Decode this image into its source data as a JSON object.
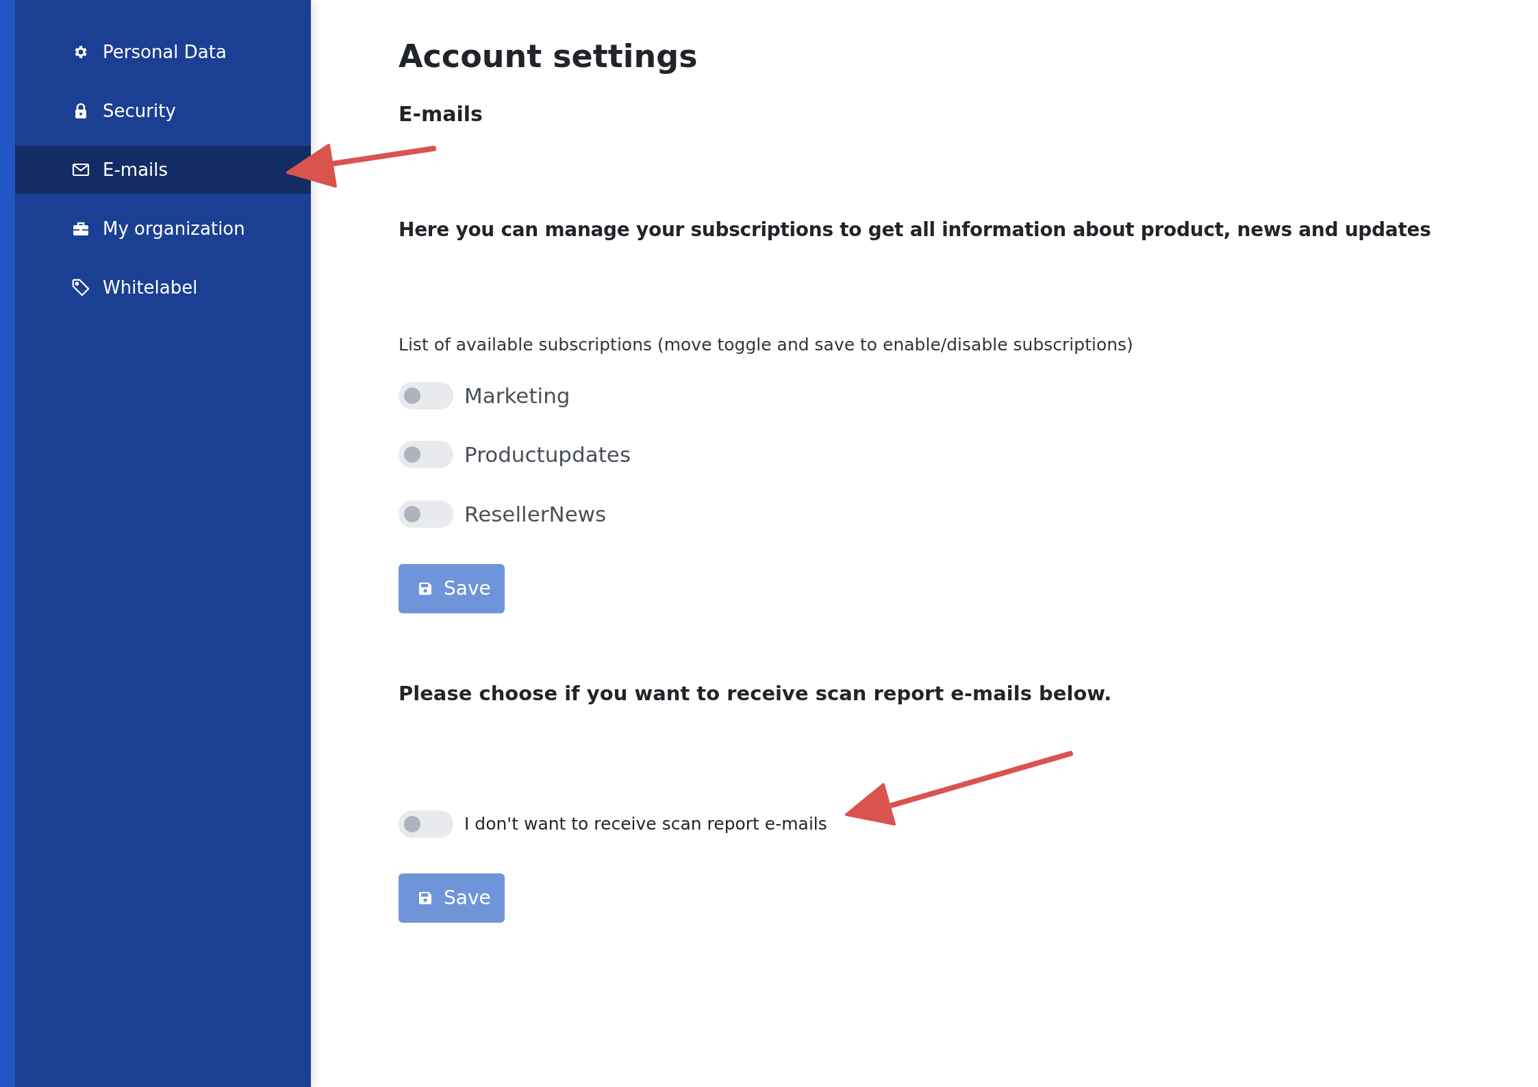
{
  "sidebar": {
    "items": [
      {
        "label": "Personal Data",
        "selected": false
      },
      {
        "label": "Security",
        "selected": false
      },
      {
        "label": "E-mails",
        "selected": true
      },
      {
        "label": "My organization",
        "selected": false
      },
      {
        "label": "Whitelabel",
        "selected": false
      }
    ]
  },
  "main": {
    "title": "Account settings",
    "section_title": "E-mails",
    "subscriptions": {
      "heading": "Here you can manage your subscriptions to get all information about product, news and updates",
      "hint": "List of available subscriptions (move toggle and save to enable/disable subscriptions)",
      "toggles": [
        {
          "label": "Marketing",
          "on": false
        },
        {
          "label": "Productupdates",
          "on": false
        },
        {
          "label": "ResellerNews",
          "on": false
        }
      ],
      "save_button": "Save"
    },
    "scan_reports": {
      "heading": "Please choose if you want to receive scan report e-mails below.",
      "toggle": {
        "label": "I don't want to receive scan report e-mails",
        "on": false
      },
      "save_button": "Save"
    }
  }
}
